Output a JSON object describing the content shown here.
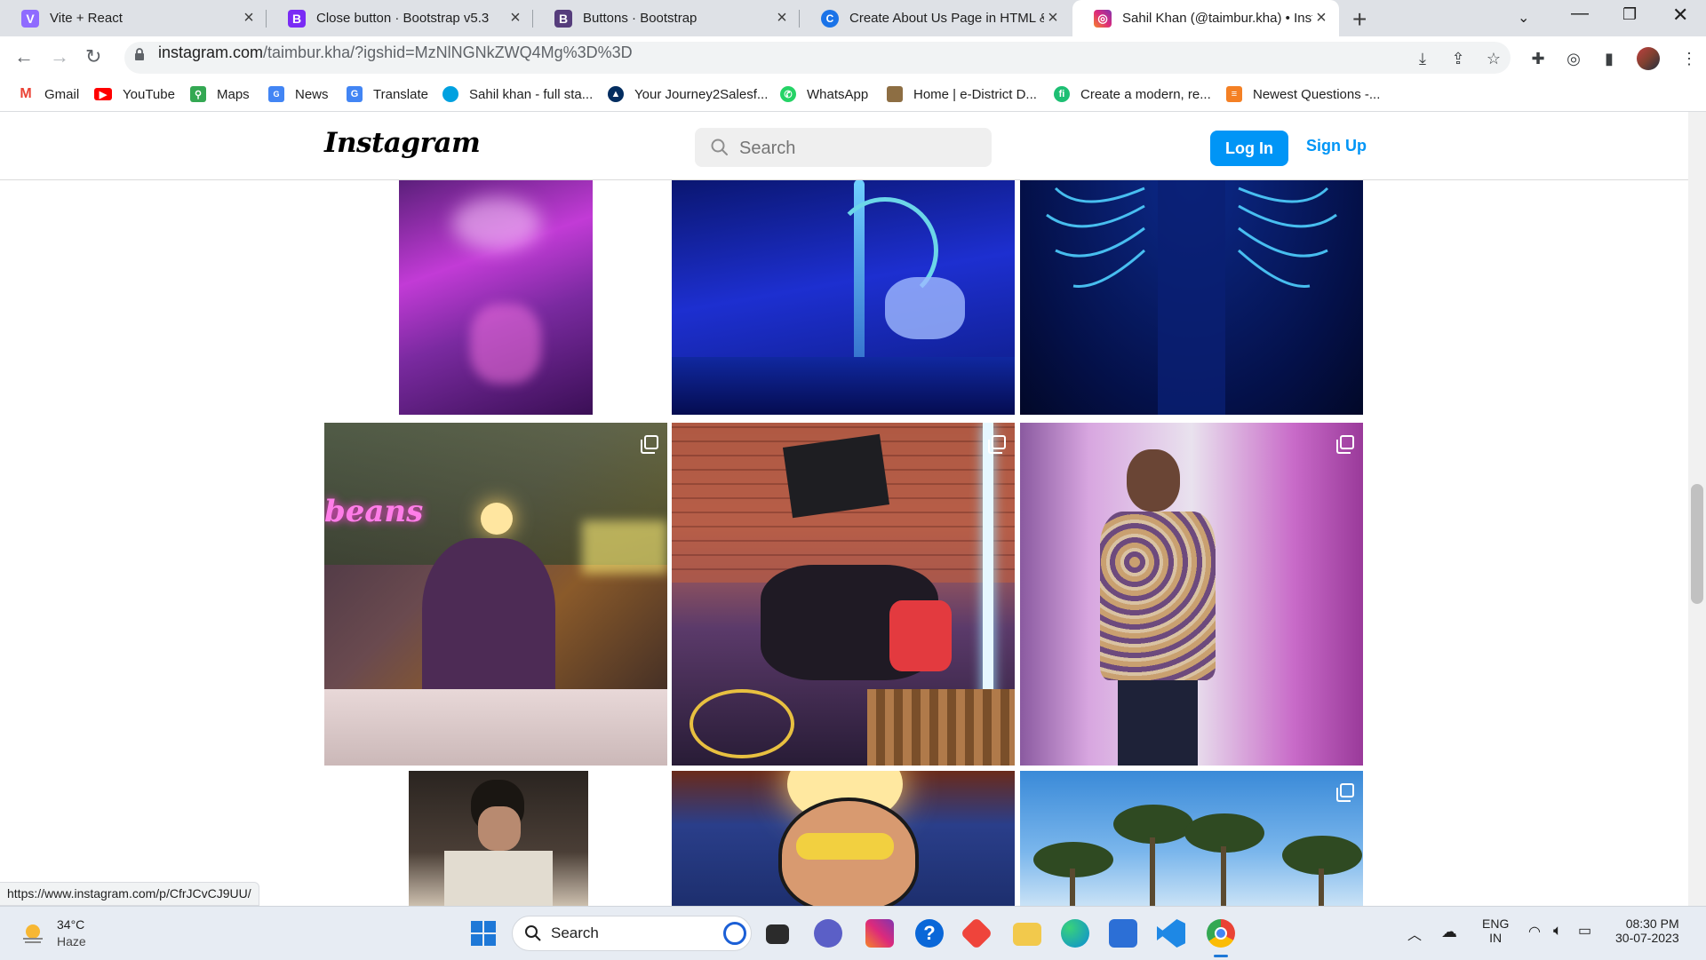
{
  "browser": {
    "tabs": [
      {
        "title": "Vite + React",
        "favicon_color": "#8f6bff",
        "favicon_glyph": "V",
        "active": false
      },
      {
        "title": "Close button · Bootstrap v5.3",
        "favicon_color": "#7a2bf5",
        "favicon_glyph": "B",
        "active": false
      },
      {
        "title": "Buttons · Bootstrap",
        "favicon_color": "#563d7c",
        "favicon_glyph": "B",
        "active": false
      },
      {
        "title": "Create About Us Page in HTML &",
        "favicon_color": "#1a73e8",
        "favicon_glyph": "C",
        "active": false
      },
      {
        "title": "Sahil Khan (@taimbur.kha) • Insta",
        "favicon_color": "#e1306c",
        "favicon_glyph": "◎",
        "active": true
      }
    ],
    "address": {
      "host": "instagram.com",
      "path": "/taimbur.kha/?igshid=MzNlNGNkZWQ4Mg%3D%3D"
    },
    "bookmarks": [
      {
        "label": "Gmail",
        "icon": "gmail-icon",
        "color": "#ea4335"
      },
      {
        "label": "YouTube",
        "icon": "youtube-icon",
        "color": "#ff0000"
      },
      {
        "label": "Maps",
        "icon": "maps-icon",
        "color": "#34a853"
      },
      {
        "label": "News",
        "icon": "news-icon",
        "color": "#4285f4"
      },
      {
        "label": "Translate",
        "icon": "translate-icon",
        "color": "#4285f4"
      },
      {
        "label": "Sahil khan - full sta...",
        "icon": "salesforce-icon",
        "color": "#00a1e0"
      },
      {
        "label": "Your Journey2Salesf...",
        "icon": "trailhead-icon",
        "color": "#032d60"
      },
      {
        "label": "WhatsApp",
        "icon": "whatsapp-icon",
        "color": "#25d366"
      },
      {
        "label": "Home | e-District D...",
        "icon": "emblem-icon",
        "color": "#8d6e43"
      },
      {
        "label": "Create a modern, re...",
        "icon": "fiverr-icon",
        "color": "#1dbf73"
      },
      {
        "label": "Newest Questions -...",
        "icon": "stackoverflow-icon",
        "color": "#f48024"
      }
    ],
    "status_url": "https://www.instagram.com/p/CfrJCvCJ9UU/"
  },
  "instagram": {
    "logo": "Instagram",
    "search_placeholder": "Search",
    "login_label": "Log In",
    "signup_label": "Sign Up",
    "accent": "#0095f6",
    "posts": [
      {
        "name": "post-purple-smoke-party",
        "multi": false
      },
      {
        "name": "post-blue-hookah-table",
        "multi": false
      },
      {
        "name": "post-neon-wings",
        "multi": false
      },
      {
        "name": "post-cafe-neon-beans",
        "multi": true
      },
      {
        "name": "post-group-brick-wall",
        "multi": true
      },
      {
        "name": "post-floral-jacket",
        "multi": true
      },
      {
        "name": "post-portrait-phone",
        "multi": false
      },
      {
        "name": "post-mural-painting",
        "multi": false
      },
      {
        "name": "post-palm-trees",
        "multi": true
      }
    ],
    "neon_sign": "beans"
  },
  "taskbar": {
    "weather": {
      "temp": "34°C",
      "condition": "Haze"
    },
    "search_label": "Search",
    "apps": [
      {
        "name": "copilot-icon",
        "color": "#1b5fd6"
      },
      {
        "name": "task-view-icon",
        "color": "#2b2b2b"
      },
      {
        "name": "teams-meet-icon",
        "color": "#5b5fc7"
      },
      {
        "name": "instagram-icon",
        "color": "#d62976"
      },
      {
        "name": "help-icon",
        "color": "#0a67d8"
      },
      {
        "name": "anydesk-icon",
        "color": "#ef443b"
      },
      {
        "name": "file-explorer-icon",
        "color": "#f2c94c"
      },
      {
        "name": "edge-icon",
        "color": "#0c8dd6"
      },
      {
        "name": "store-icon",
        "color": "#2c6fd6"
      },
      {
        "name": "vscode-icon",
        "color": "#1e88e5"
      },
      {
        "name": "chrome-icon",
        "color": "#34a853"
      }
    ],
    "lang": {
      "line1": "ENG",
      "line2": "IN"
    },
    "clock": {
      "time": "08:30 PM",
      "date": "30-07-2023"
    }
  }
}
